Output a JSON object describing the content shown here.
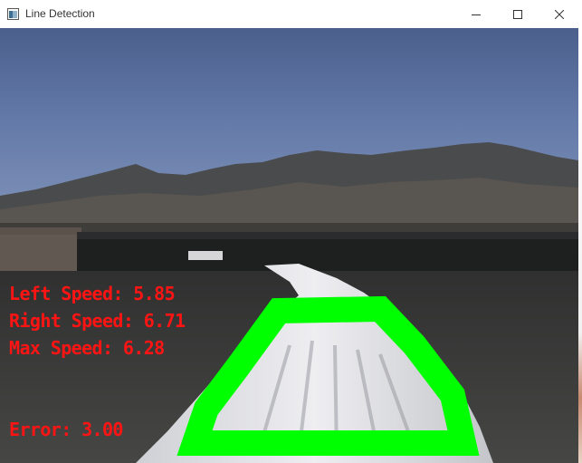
{
  "window": {
    "title": "Line Detection",
    "controls": [
      "minimize",
      "maximize",
      "close"
    ]
  },
  "overlay": {
    "left_speed": "Left Speed: 5.85",
    "right_speed": "Right Speed: 6.71",
    "max_speed": "Max Speed: 6.28",
    "error": "Error: 3.00"
  },
  "colors": {
    "overlay_text": "#ff1414",
    "detected_line": "#00ff00",
    "sky": "#5a6f9e",
    "road": "#3c3d3b"
  }
}
